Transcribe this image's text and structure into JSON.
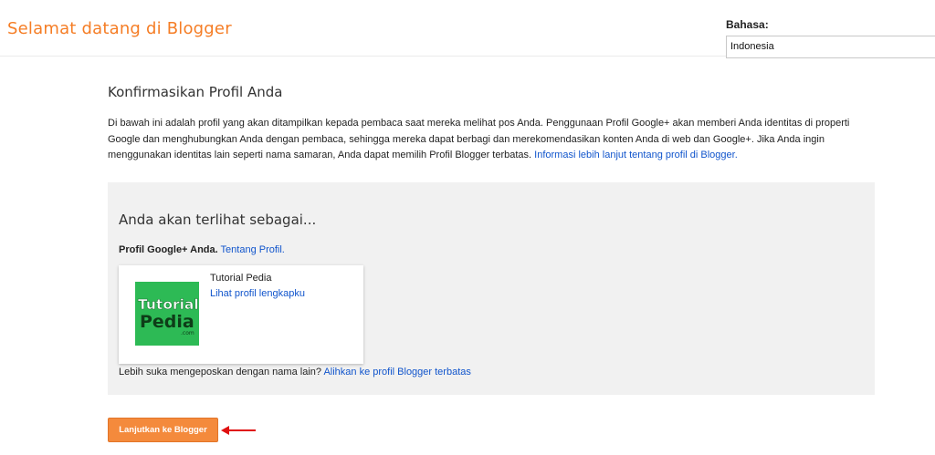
{
  "header": {
    "title": "Selamat datang di Blogger",
    "language_label": "Bahasa:",
    "language_value": "Indonesia"
  },
  "main": {
    "section_title": "Konfirmasikan Profil Anda",
    "intro_text": "Di bawah ini adalah profil yang akan ditampilkan kepada pembaca saat mereka melihat pos Anda. Penggunaan Profil Google+ akan memberi Anda identitas di properti Google dan menghubungkan Anda dengan pembaca, sehingga mereka dapat berbagi dan merekomendasikan konten Anda di web dan Google+. Jika Anda ingin menggunakan identitas lain seperti nama samaran, Anda dapat memilih Profil Blogger terbatas.",
    "intro_link": "Informasi lebih lanjut tentang profil di Blogger."
  },
  "panel": {
    "title": "Anda akan terlihat sebagai...",
    "gplus_label": "Profil Google+ Anda.",
    "gplus_link": "Tentang Profil.",
    "profile": {
      "name": "Tutorial Pedia",
      "view_link": "Lihat profil lengkapku",
      "avatar_text_1": "Tutorial",
      "avatar_text_2": "Pedia",
      "avatar_text_3": ".com",
      "avatar_color": "#2dba55"
    },
    "alt_text": "Lebih suka mengeposkan dengan nama lain?",
    "alt_link": "Alihkan ke profil Blogger terbatas"
  },
  "actions": {
    "continue_label": "Lanjutkan ke Blogger"
  },
  "colors": {
    "brand_orange": "#f57d25",
    "button_orange": "#f48a3c",
    "link_blue": "#1155cc",
    "arrow_red": "#e01010"
  }
}
